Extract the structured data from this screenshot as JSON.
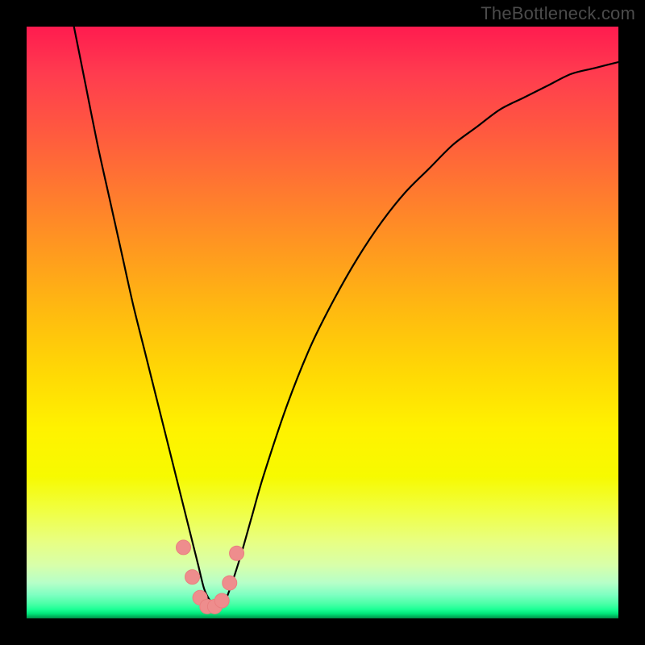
{
  "watermark": "TheBottleneck.com",
  "colors": {
    "frame": "#000000",
    "curve": "#000000",
    "marker_fill": "#ee8d8d",
    "marker_stroke": "#e97f7f",
    "gradient_top": "#ff1b4f",
    "gradient_mid": "#fff200",
    "gradient_bottom": "#008f48"
  },
  "chart_data": {
    "type": "line",
    "title": "",
    "xlabel": "",
    "ylabel": "",
    "xlim": [
      0,
      100
    ],
    "ylim": [
      0,
      100
    ],
    "grid": false,
    "legend": false,
    "series": [
      {
        "name": "bottleneck-curve",
        "x": [
          6,
          8,
          10,
          12,
          14,
          16,
          18,
          20,
          22,
          24,
          26,
          27,
          28,
          29,
          30,
          31,
          32,
          33,
          34,
          36,
          38,
          40,
          44,
          48,
          52,
          56,
          60,
          64,
          68,
          72,
          76,
          80,
          84,
          88,
          92,
          96,
          100
        ],
        "y": [
          110,
          100,
          90,
          80,
          71,
          62,
          53,
          45,
          37,
          29,
          21,
          17,
          13,
          9,
          5,
          3,
          2,
          2,
          4,
          10,
          17,
          24,
          36,
          46,
          54,
          61,
          67,
          72,
          76,
          80,
          83,
          86,
          88,
          90,
          92,
          93,
          94
        ]
      }
    ],
    "markers": {
      "name": "highlight-points",
      "x": [
        26.5,
        28.0,
        29.3,
        30.5,
        31.8,
        33.0,
        34.3,
        35.5
      ],
      "y": [
        12.0,
        7.0,
        3.5,
        2.0,
        2.0,
        3.0,
        6.0,
        11.0
      ]
    }
  }
}
